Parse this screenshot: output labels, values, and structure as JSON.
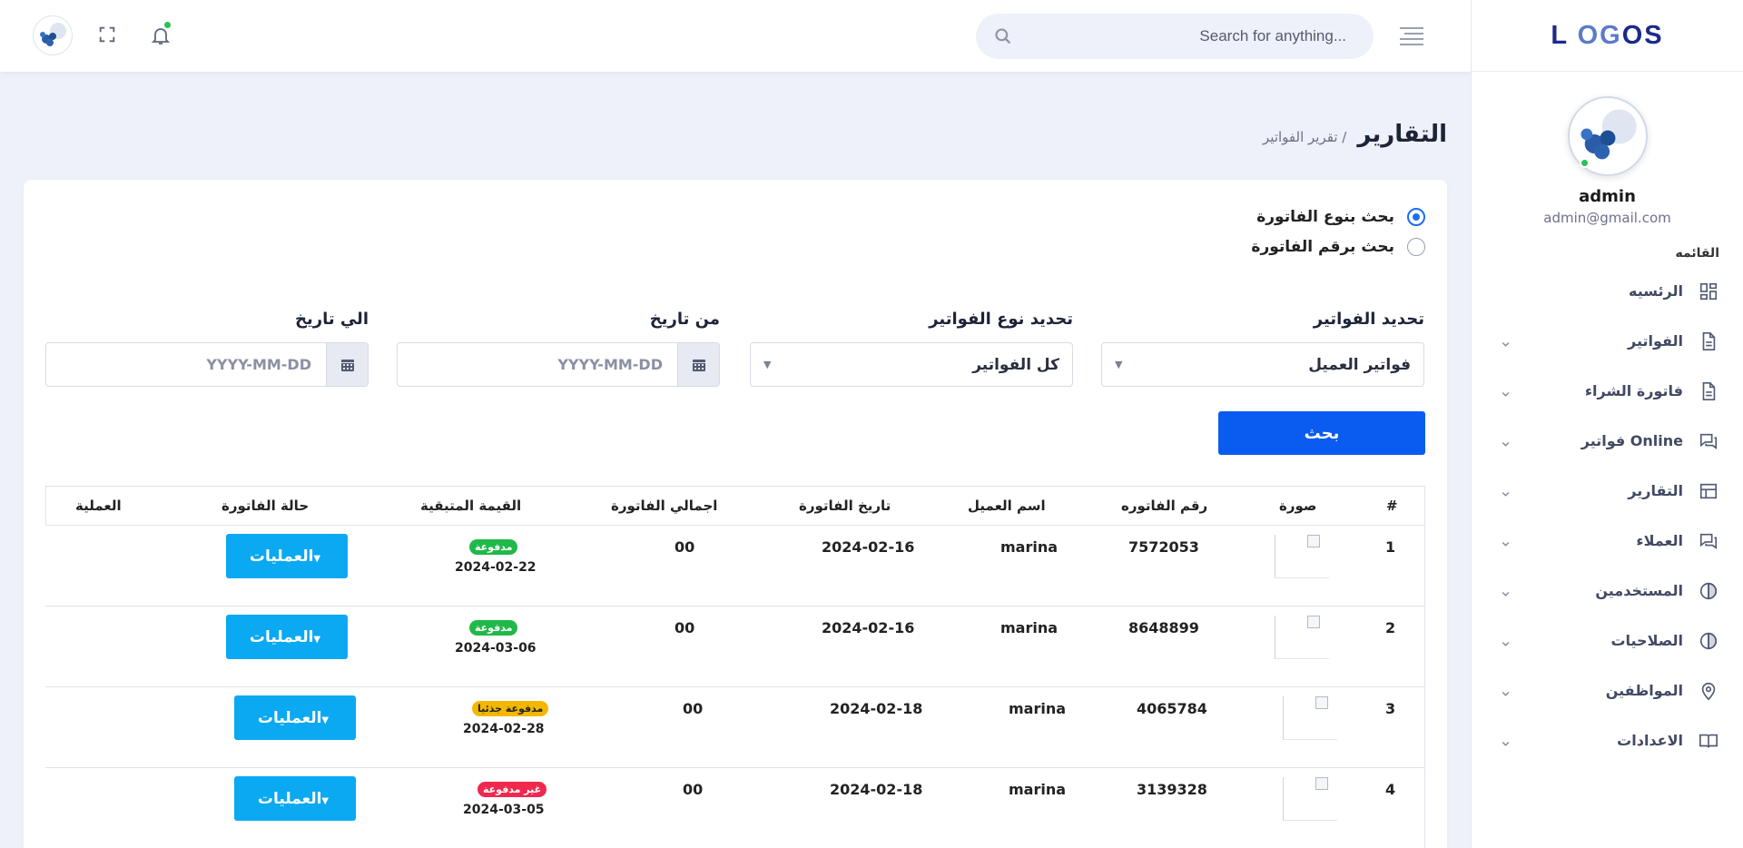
{
  "brand": {
    "text": "LOGOS"
  },
  "header": {
    "search_placeholder": "Search for anything...",
    "icons": [
      "menu-icon",
      "search-icon",
      "bell-icon",
      "fullscreen-icon"
    ]
  },
  "profile": {
    "name": "admin",
    "email": "admin@gmail.com",
    "status_color": "#2bc150"
  },
  "sidebar": {
    "menu_title": "القائمه",
    "items": [
      {
        "label": "الرئسيه",
        "icon": "dashboard-icon",
        "chevron": false
      },
      {
        "label": "الفواتير",
        "icon": "document-icon",
        "chevron": true
      },
      {
        "label": "فاتورة الشراء",
        "icon": "document-icon",
        "chevron": true
      },
      {
        "label": "فواتير Online",
        "icon": "chat-icon",
        "chevron": true
      },
      {
        "label": "التقارير",
        "icon": "table-icon",
        "chevron": true
      },
      {
        "label": "العملاء",
        "icon": "chat-icon",
        "chevron": true
      },
      {
        "label": "المستخدمين",
        "icon": "half-circle-icon",
        "chevron": true
      },
      {
        "label": "الصلاحيات",
        "icon": "half-circle-icon",
        "chevron": true
      },
      {
        "label": "المواظفين",
        "icon": "pin-icon",
        "chevron": true
      },
      {
        "label": "الاعدادات",
        "icon": "book-icon",
        "chevron": true
      }
    ]
  },
  "page": {
    "title": "التقارير",
    "breadcrumb": "/ تقرير الفواتير"
  },
  "filters": {
    "radios": [
      {
        "label": "بحث بنوع الفاتورة",
        "checked": true
      },
      {
        "label": "بحث برقم الفاتورة",
        "checked": false
      }
    ],
    "invoice_select_label": "تحديد الفواتير",
    "invoice_select_value": "فواتير العميل",
    "type_select_label": "تحديد نوع الفواتير",
    "type_select_value": "كل الفواتير",
    "from_label": "من تاريخ",
    "to_label": "الي تاريخ",
    "date_placeholder": "YYYY-MM-DD",
    "search_button": "بحث"
  },
  "table": {
    "headers": [
      "#",
      "صورة",
      "رقم الفاتوره",
      "اسم العميل",
      "تاريخ الفاتورة",
      "اجمالي الفاتورة",
      "القيمة المتبقية",
      "حالة الفاتورة",
      "العملية"
    ],
    "ops_label": "العمليات",
    "rows": [
      {
        "num": "1",
        "invoice": "7572053",
        "client": "marina",
        "date": "2024-02-16",
        "total": "00",
        "status": "مدفوعة",
        "status_color": "green",
        "status_date": "2024-02-22"
      },
      {
        "num": "2",
        "invoice": "8648899",
        "client": "marina",
        "date": "2024-02-16",
        "total": "00",
        "status": "مدفوعة",
        "status_color": "green",
        "status_date": "2024-03-06"
      },
      {
        "num": "3",
        "invoice": "4065784",
        "client": "marina",
        "date": "2024-02-18",
        "total": "00",
        "status": "مدفوعة جذئيا",
        "status_color": "yellow",
        "status_date": "2024-02-28"
      },
      {
        "num": "4",
        "invoice": "3139328",
        "client": "marina",
        "date": "2024-02-18",
        "total": "00",
        "status": "غير مدفوعة",
        "status_color": "red",
        "status_date": "2024-03-05"
      }
    ]
  },
  "colors": {
    "primary": "#0a5cf0",
    "ops": "#0aa9f2",
    "paid": "#1fb94a",
    "partial": "#f4b700",
    "unpaid": "#f0284e"
  }
}
